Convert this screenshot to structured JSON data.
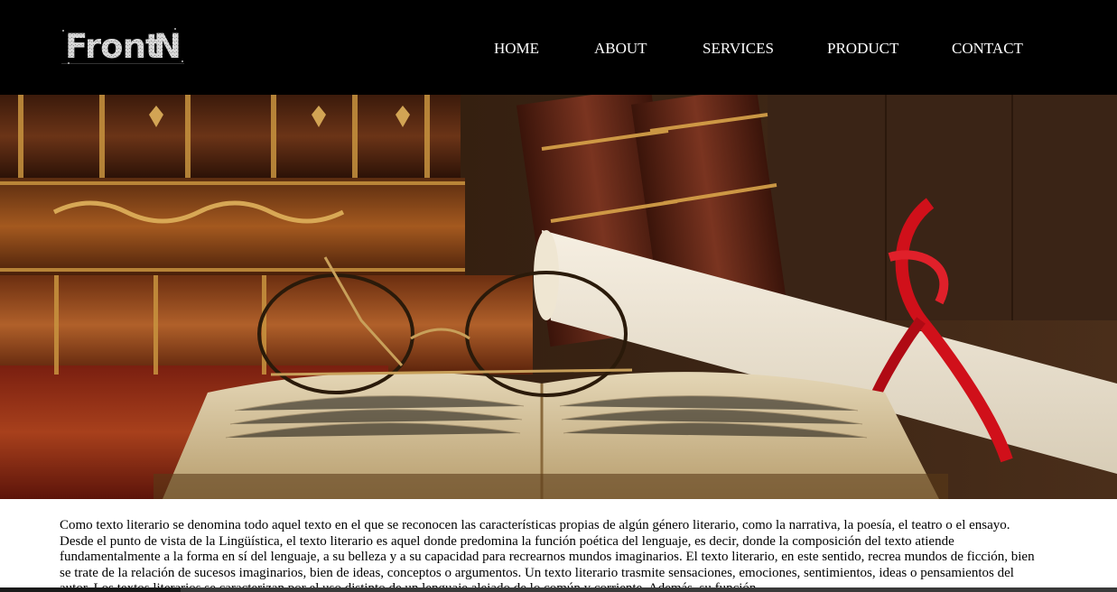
{
  "header": {
    "logo_text": "Front N",
    "background": "#000000"
  },
  "nav": {
    "items": [
      {
        "label": "HOME"
      },
      {
        "label": "ABOUT"
      },
      {
        "label": "SERVICES"
      },
      {
        "label": "PRODUCT"
      },
      {
        "label": "CONTACT"
      }
    ]
  },
  "hero": {
    "image": "books-glasses-scroll-photo",
    "accent_ribbon": "#d0101a"
  },
  "content": {
    "paragraph": "Como texto literario se denomina todo aquel texto en el que se reconocen las características propias de algún género literario, como la narrativa, la poesía, el teatro o el ensayo. Desde el punto de vista de la Lingüística, el texto literario es aquel donde predomina la función poética del lenguaje, es decir, donde la composición del texto atiende fundamentalmente a la forma en sí del lenguaje, a su belleza y a su capacidad para recrearnos mundos imaginarios. El texto literario, en este sentido, recrea mundos de ficción, bien se trate de la relación de sucesos imaginarios, bien de ideas, conceptos o argumentos. Un texto literario trasmite sensaciones, emociones, sentimientos, ideas o pensamientos del autor. Los textos literarios se caracterizan por el uso distinto de un lenguaje alejado de lo común y corriente. Además, su función"
  }
}
